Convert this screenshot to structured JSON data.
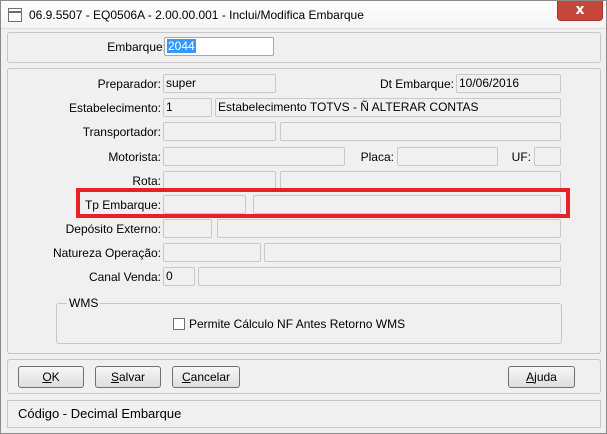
{
  "window": {
    "title": "06.9.5507 - EQ0506A - 2.00.00.001 - Inclui/Modifica Embarque",
    "close_glyph": "x"
  },
  "header": {
    "embarque_label": "Embarque:",
    "embarque_value": "2044"
  },
  "form": {
    "preparador_label": "Preparador:",
    "preparador_value": "super",
    "dt_embarque_label": "Dt Embarque:",
    "dt_embarque_value": "10/06/2016",
    "estabelecimento_label": "Estabelecimento:",
    "estabelecimento_code": "1",
    "estabelecimento_name": "Estabelecimento TOTVS - Ñ ALTERAR CONTAS",
    "transportador_label": "Transportador:",
    "transportador_code": "",
    "transportador_name": "",
    "motorista_label": "Motorista:",
    "motorista_value": "",
    "placa_label": "Placa:",
    "placa_value": "",
    "uf_label": "UF:",
    "uf_value": "",
    "rota_label": "Rota:",
    "rota_code": "",
    "rota_name": "",
    "tp_embarque_label": "Tp Embarque:",
    "tp_embarque_code": "",
    "tp_embarque_name": "",
    "deposito_label": "Depósito Externo:",
    "deposito_code": "",
    "deposito_name": "",
    "natureza_label": "Natureza Operação:",
    "natureza_code": "",
    "natureza_name": "",
    "canal_label": "Canal Venda:",
    "canal_code": "0",
    "canal_name": ""
  },
  "wms": {
    "group_title": "WMS",
    "checkbox_label": "Permite Cálculo NF Antes Retorno WMS",
    "checked": false
  },
  "buttons": {
    "ok_u": "O",
    "ok_rest": "K",
    "salvar_u": "S",
    "salvar_rest": "alvar",
    "cancelar_u": "C",
    "cancelar_rest": "ancelar",
    "ajuda_u": "A",
    "ajuda_rest": "juda"
  },
  "status": {
    "text": "Código - Decimal Embarque"
  },
  "colors": {
    "highlight": "#e8202a",
    "selection": "#3399ff",
    "close_button": "#c7463c"
  }
}
